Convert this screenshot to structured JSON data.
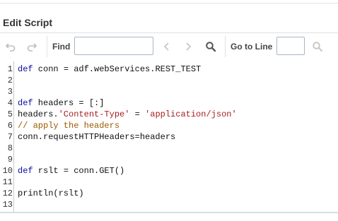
{
  "panel": {
    "title": "Edit Script"
  },
  "toolbar": {
    "undo_icon": "undo-icon",
    "redo_icon": "redo-icon",
    "find_label": "Find",
    "find_value": "",
    "prev_icon": "chevron-left-icon",
    "next_icon": "chevron-right-icon",
    "search_icon": "search-icon",
    "goto_label": "Go to Line",
    "goto_value": "",
    "goto_search_icon": "search-icon"
  },
  "colors": {
    "keyword": "#0a0aa0",
    "string": "#a51d1d",
    "comment": "#9a5a00",
    "text": "#111111"
  },
  "editor": {
    "lines": [
      {
        "number": "1",
        "segments": [
          {
            "t": "def",
            "c": "kw"
          },
          {
            "t": " conn = adf.webServices.REST_TEST"
          }
        ]
      },
      {
        "number": "2",
        "segments": []
      },
      {
        "number": "3",
        "segments": []
      },
      {
        "number": "4",
        "segments": [
          {
            "t": "def",
            "c": "kw"
          },
          {
            "t": " headers = [:]"
          }
        ]
      },
      {
        "number": "5",
        "segments": [
          {
            "t": "headers."
          },
          {
            "t": "'Content-Type'",
            "c": "str"
          },
          {
            "t": " = "
          },
          {
            "t": "'application/json'",
            "c": "str"
          }
        ]
      },
      {
        "number": "6",
        "segments": [
          {
            "t": "// apply the headers",
            "c": "cm"
          }
        ]
      },
      {
        "number": "7",
        "segments": [
          {
            "t": "conn.requestHTTPHeaders=headers"
          }
        ]
      },
      {
        "number": "8",
        "segments": []
      },
      {
        "number": "9",
        "segments": []
      },
      {
        "number": "10",
        "segments": [
          {
            "t": "def",
            "c": "kw"
          },
          {
            "t": " rslt = conn.GET()"
          }
        ]
      },
      {
        "number": "11",
        "segments": []
      },
      {
        "number": "12",
        "segments": [
          {
            "t": "println(rslt)"
          }
        ]
      },
      {
        "number": "13",
        "segments": []
      }
    ]
  }
}
